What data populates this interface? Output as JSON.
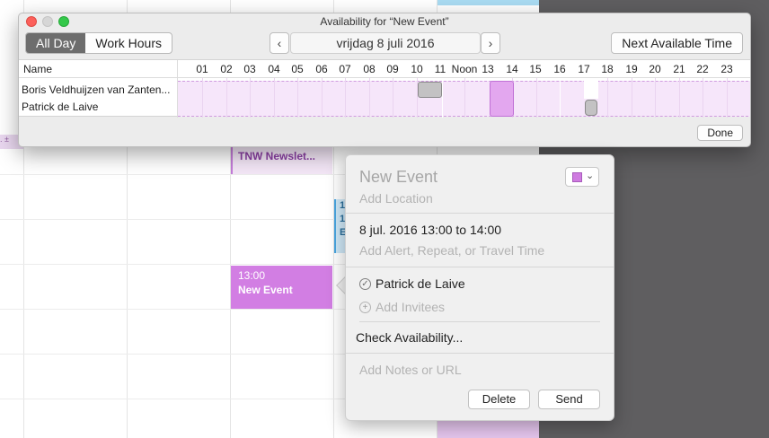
{
  "window": {
    "title": "Availability for “New Event”"
  },
  "toolbar": {
    "all_day_label": "All Day",
    "work_hours_label": "Work Hours",
    "date_label": "vrijdag 8 juli 2016",
    "prev_label": "‹",
    "next_label": "›",
    "next_available_label": "Next Available Time"
  },
  "grid": {
    "name_header": "Name",
    "hours": [
      "01",
      "02",
      "03",
      "04",
      "05",
      "06",
      "07",
      "08",
      "09",
      "10",
      "11",
      "Noon",
      "13",
      "14",
      "15",
      "16",
      "17",
      "18",
      "19",
      "20",
      "21",
      "22",
      "23"
    ],
    "people": [
      "Boris Veldhuijzen van Zanten...",
      "Patrick de Laive"
    ]
  },
  "done_label": "Done",
  "calendar_bg": {
    "newsletter_event": "TNW Newslet...",
    "new_event_time": "13:00",
    "new_event_title": "New Event",
    "blue_event_lines": [
      "1",
      "1",
      "E"
    ],
    "left_strip_label": ". ±"
  },
  "popover": {
    "title": "New Event",
    "location_placeholder": "Add Location",
    "date_time": "8 jul. 2016  13:00 to 14:00",
    "alert_placeholder": "Add Alert, Repeat, or Travel Time",
    "invitee": "Patrick de Laive",
    "add_invitees": "Add Invitees",
    "check_availability": "Check Availability...",
    "notes_placeholder": "Add Notes or URL",
    "delete_label": "Delete",
    "send_label": "Send",
    "color_chevron": "⌄"
  },
  "colors": {
    "event_purple": "#d27ee3",
    "band_fill": "#f6e6fa",
    "busy_gray": "#c3c2c3"
  }
}
